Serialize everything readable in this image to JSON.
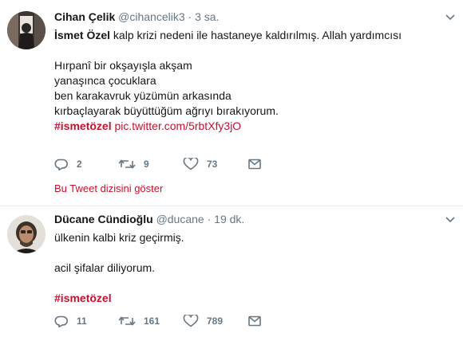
{
  "tweets": [
    {
      "author_name": "Cihan Çelik",
      "handle": "@cihancelik3",
      "separator": "·",
      "time": "3 sa.",
      "text_bold": "İsmet Özel",
      "text_first": " kalp krizi nedeni ile hastaneye kaldırılmış. Allah yardımcısı",
      "poem": [
        "Hırpanî bir okşayışla akşam",
        "yanaşınca çocuklara",
        "ben karakavruk yüzümün arkasında",
        "kırbaçlayarak büyüttüğüm ağrıyı bırakıyorum."
      ],
      "hashtag": "#ismetözel",
      "link": "pic.twitter.com/5rbtXfy3jO",
      "replies": "2",
      "retweets": "9",
      "likes": "73",
      "thread_link": "Bu Tweet dizisini göster"
    },
    {
      "author_name": "Dücane Cündioğlu",
      "handle": "@ducane",
      "separator": "·",
      "time": "19 dk.",
      "lines": [
        "ülkenin kalbi kriz geçirmiş.",
        "acil şifalar diliyorum."
      ],
      "hashtag": "#ismetözel",
      "replies": "11",
      "retweets": "161",
      "likes": "789"
    }
  ],
  "colors": {
    "accent": "#c8102e",
    "muted": "#657786",
    "text": "#14171a",
    "divider": "#e6ecf0"
  },
  "icons": {
    "reply": "reply-icon",
    "retweet": "retweet-icon",
    "like": "heart-icon",
    "dm": "envelope-icon",
    "caret": "chevron-down-icon"
  }
}
